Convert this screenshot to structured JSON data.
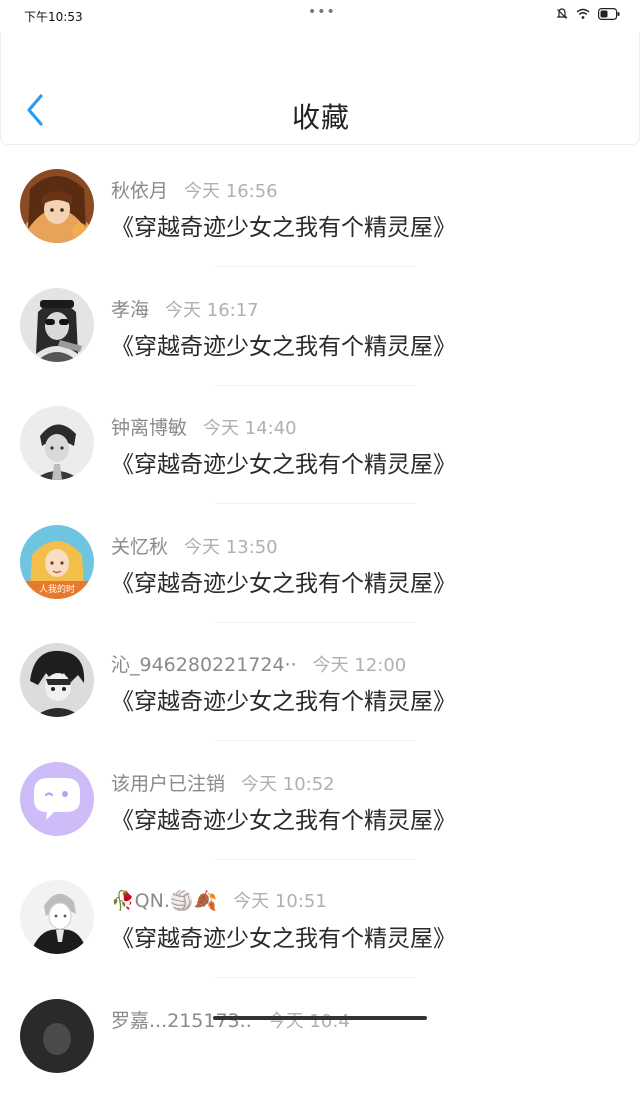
{
  "status": {
    "time": "下午10:53",
    "dots": "•••"
  },
  "header": {
    "title": "收藏"
  },
  "items": [
    {
      "name": "秋依月",
      "time": "今天 16:56",
      "book": "《穿越奇迹少女之我有个精灵屋》",
      "avatar": "avatar-girl-anime"
    },
    {
      "name": "孝海",
      "time": "今天 16:17",
      "book": "《穿越奇迹少女之我有个精灵屋》",
      "avatar": "avatar-bw-sunglasses"
    },
    {
      "name": "钟离博敏",
      "time": "今天 14:40",
      "book": "《穿越奇迹少女之我有个精灵屋》",
      "avatar": "avatar-bw-boy"
    },
    {
      "name": "关忆秋",
      "time": "今天 13:50",
      "book": "《穿越奇迹少女之我有个精灵屋》",
      "avatar": "avatar-blonde-girl",
      "avatar_caption": "人我的时"
    },
    {
      "name": "沁_946280221724··",
      "time": "今天 12:00",
      "book": "《穿越奇迹少女之我有个精灵屋》",
      "avatar": "avatar-dark-anime"
    },
    {
      "name": "该用户已注销",
      "time": "今天 10:52",
      "book": "《穿越奇迹少女之我有个精灵屋》",
      "avatar": "avatar-default-purple"
    },
    {
      "name": "🥀QN.🏐🍂",
      "time": "今天 10:51",
      "book": "《穿越奇迹少女之我有个精灵屋》",
      "avatar": "avatar-bw-sketch"
    }
  ],
  "partial_item": {
    "name": "罗嘉...215173..",
    "time": "今天 10:4"
  },
  "colors": {
    "accent": "#2c9cf0",
    "meta": "#8a8a8a",
    "time": "#b0b0b0",
    "default_avatar_bg": "#cdbcf7"
  }
}
